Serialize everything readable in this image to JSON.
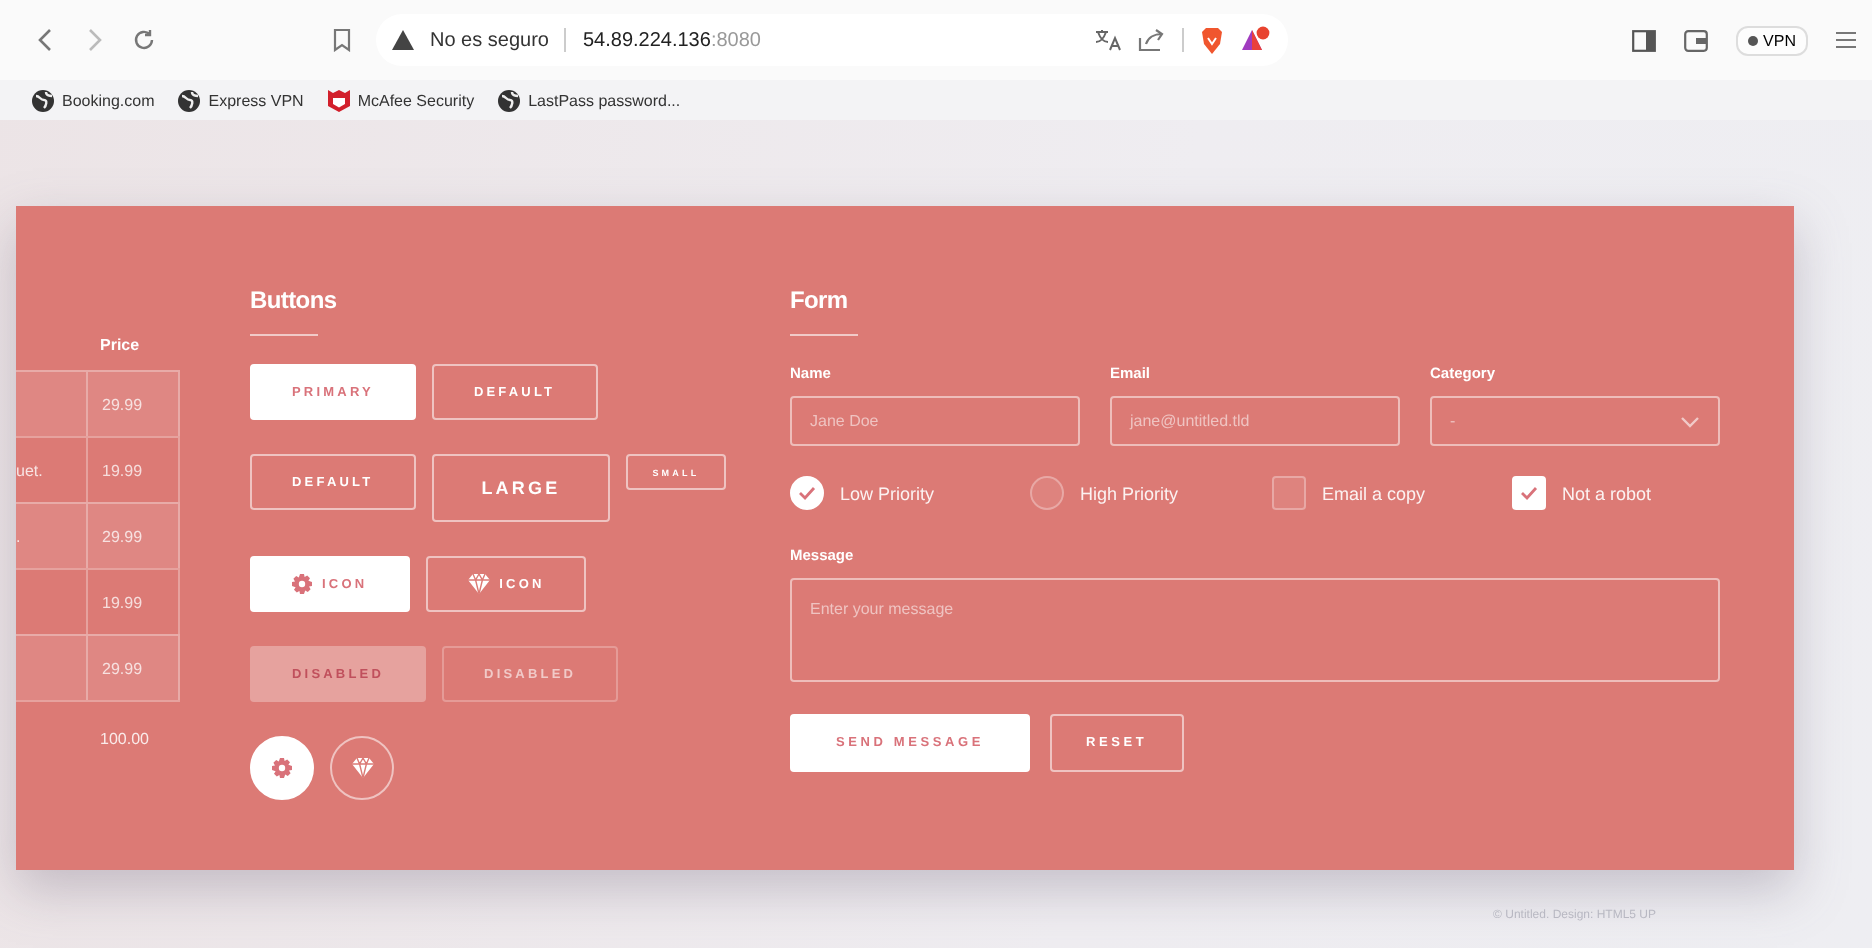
{
  "browser": {
    "security": "No es seguro",
    "url_host": "54.89.224.136",
    "url_port": ":8080",
    "bookmarks": [
      {
        "label": "Booking.com",
        "kind": "globe"
      },
      {
        "label": "Express VPN",
        "kind": "globe"
      },
      {
        "label": "McAfee Security",
        "kind": "shield"
      },
      {
        "label": "LastPass password...",
        "kind": "globe"
      }
    ],
    "vpn": "VPN"
  },
  "table": {
    "columns": [
      "Price"
    ],
    "rows": [
      {
        "column_1": "",
        "price": "29.99"
      },
      {
        "column_1": "uet.",
        "price": "19.99"
      },
      {
        "column_1": ".",
        "price": "29.99"
      },
      {
        "column_1": "",
        "price": "19.99"
      },
      {
        "column_1": "",
        "price": "29.99"
      }
    ],
    "total": "100.00"
  },
  "buttons": {
    "title": "Buttons",
    "rows": [
      {
        "items": [
          {
            "label": "PRIMARY",
            "kind": "primary",
            "disabled": false
          },
          {
            "label": "DEFAULT",
            "kind": "default",
            "disabled": false
          }
        ]
      },
      {
        "items": [
          {
            "label": "DEFAULT",
            "kind": "default",
            "disabled": false
          },
          {
            "label": "LARGE",
            "kind": "large",
            "disabled": false
          },
          {
            "label": "SMALL",
            "kind": "small",
            "disabled": false
          }
        ]
      },
      {
        "items": [
          {
            "label": "ICON",
            "kind": "gearprimary",
            "disabled": false
          },
          {
            "label": "ICON",
            "kind": "diamonddefault",
            "disabled": false
          }
        ]
      },
      {
        "items": [
          {
            "label": "DISABLED",
            "kind": "primary",
            "disabled": true
          },
          {
            "label": "DISABLED",
            "kind": "default",
            "disabled": true
          }
        ]
      },
      {
        "items": [
          {
            "kind": "gearcircle",
            "disabled": false
          },
          {
            "kind": "diamondcircle",
            "disabled": false
          }
        ]
      }
    ]
  },
  "form": {
    "title": "Form",
    "fields": [
      {
        "label": "Name",
        "placeholder": "Jane Doe",
        "kind": "text"
      },
      {
        "label": "Email",
        "placeholder": "jane@untitled.tld",
        "kind": "text"
      },
      {
        "label": "Category",
        "value": "-",
        "kind": "select"
      }
    ],
    "options": [
      {
        "label": "Low Priority",
        "kind": "radio",
        "checked": true
      },
      {
        "label": "High Priority",
        "kind": "radio",
        "checked": false
      },
      {
        "label": "Email a copy",
        "kind": "checkbox",
        "checked": false
      },
      {
        "label": "Not a robot",
        "kind": "checkbox",
        "checked": true
      }
    ],
    "message": {
      "label": "Message",
      "placeholder": "Enter your message"
    },
    "actions": [
      {
        "label": "SEND MESSAGE",
        "kind": "primary"
      },
      {
        "label": "RESET",
        "kind": "default"
      }
    ]
  },
  "footer": "© Untitled. Design: HTML5 UP"
}
